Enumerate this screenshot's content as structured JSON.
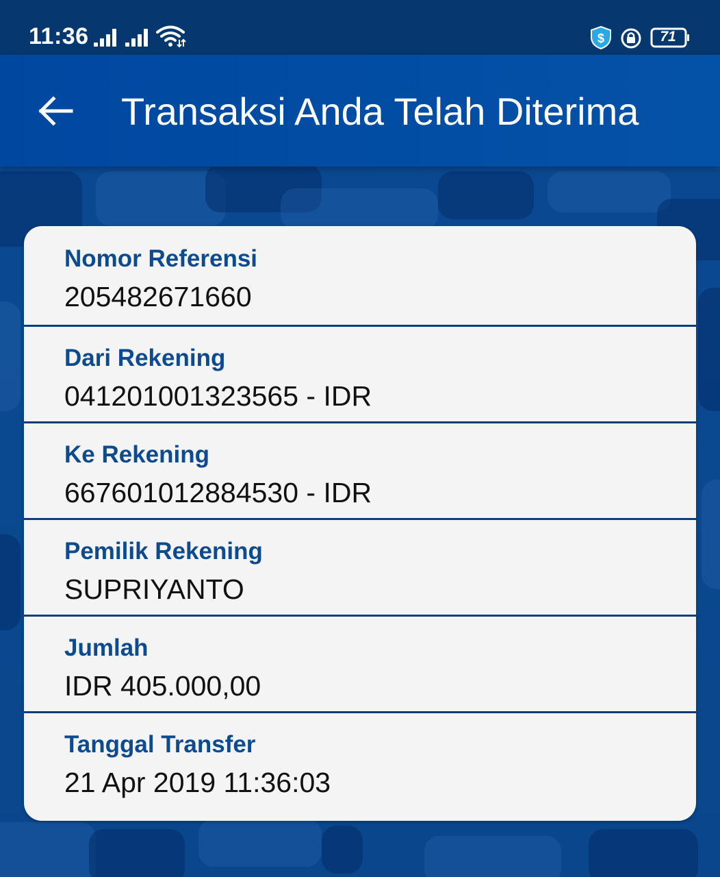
{
  "status_bar": {
    "time": "11:36",
    "battery_level": "71",
    "icons": [
      "signal-icon",
      "signal-icon",
      "wifi-icon",
      "shield-dollar-icon",
      "rotation-lock-icon",
      "battery-icon"
    ]
  },
  "app_bar": {
    "title": "Transaksi Anda Telah Diterima",
    "back_icon": "arrow-left-icon"
  },
  "details": [
    {
      "label": "Nomor Referensi",
      "value": "205482671660"
    },
    {
      "label": "Dari Rekening",
      "value": "041201001323565 - IDR"
    },
    {
      "label": "Ke Rekening",
      "value": "667601012884530 - IDR"
    },
    {
      "label": "Pemilik Rekening",
      "value": "SUPRIYANTO"
    },
    {
      "label": "Jumlah",
      "value": "IDR 405.000,00"
    },
    {
      "label": "Tanggal Transfer",
      "value": "21 Apr 2019 11:36:03"
    }
  ],
  "colors": {
    "status_bar": "#06386f",
    "app_bar": "#0047a0",
    "label": "#0d4b8e",
    "card": "#f4f4f4",
    "divider": "#0b3d78"
  }
}
